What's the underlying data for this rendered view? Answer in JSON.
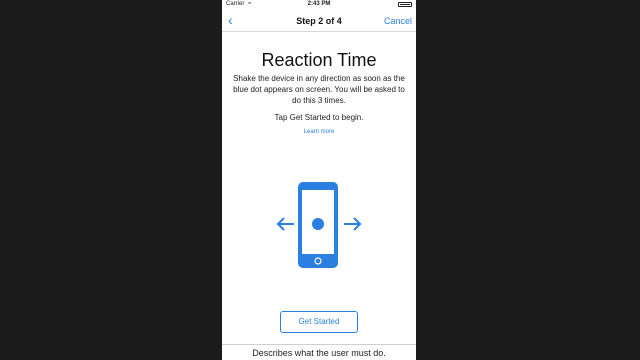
{
  "status_bar": {
    "carrier": "Carrier",
    "wifi_icon": "wifi-icon",
    "time": "2:43 PM",
    "battery_icon": "battery-icon"
  },
  "nav": {
    "back_icon": "chevron-left-icon",
    "title": "Step 2 of 4",
    "cancel_label": "Cancel"
  },
  "content": {
    "title": "Reaction Time",
    "description": "Shake the device in any direction as soon as the blue dot appears on screen. You will be asked to do this 3 times.",
    "instruction": "Tap Get Started to begin.",
    "learn_more": "Learn more",
    "illustration": {
      "phone_icon": "phone-icon",
      "left_arrow": "arrow-left-icon",
      "right_arrow": "arrow-right-icon"
    }
  },
  "actions": {
    "get_started_label": "Get Started"
  },
  "caption": "Describes what the user must do.",
  "colors": {
    "accent": "#2b7fe0",
    "background": "#1c1c1c",
    "screen": "#ffffff"
  }
}
